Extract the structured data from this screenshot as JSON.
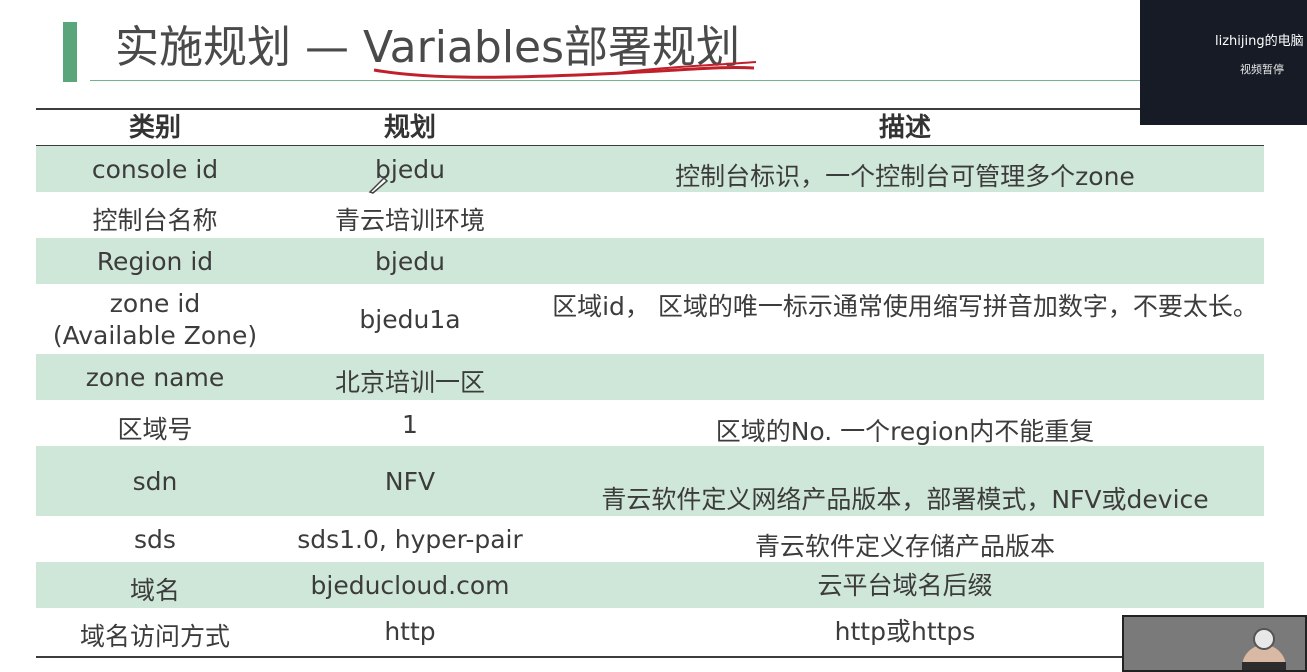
{
  "slide": {
    "title": "实施规划 — Variables部署规划",
    "table": {
      "headers": [
        "类别",
        "规划",
        "描述"
      ],
      "rows": [
        {
          "category": "console id",
          "plan": "bjedu",
          "desc": "控制台标识，一个控制台可管理多个zone",
          "shaded": true
        },
        {
          "category": "控制台名称",
          "plan": "青云培训环境",
          "desc": "",
          "shaded": false
        },
        {
          "category": "Region id",
          "plan": "bjedu",
          "desc": "",
          "shaded": true
        },
        {
          "category": "zone id\n(Available Zone)",
          "plan": "bjedu1a",
          "desc": "区域id， 区域的唯一标示通常使用缩写拼音加数字，不要太长。",
          "shaded": false
        },
        {
          "category": "zone name",
          "plan": "北京培训一区",
          "desc": "",
          "shaded": true
        },
        {
          "category": "区域号",
          "plan": "1",
          "desc": "区域的No. 一个region内不能重复",
          "shaded": false
        },
        {
          "category": "sdn",
          "plan": "NFV",
          "desc": "青云软件定义网络产品版本，部署模式，NFV或device",
          "shaded": true
        },
        {
          "category": "sds",
          "plan": "sds1.0, hyper-pair",
          "desc": "青云软件定义存储产品版本",
          "shaded": false
        },
        {
          "category": "域名",
          "plan": "bjeducloud.com",
          "desc": "云平台域名后缀",
          "shaded": true
        },
        {
          "category": "域名访问方式",
          "plan": "http",
          "desc": "http或https",
          "shaded": false
        }
      ]
    }
  },
  "video_overlay": {
    "name": "lizhijing的电脑",
    "status": "视频暂停"
  },
  "colors": {
    "accent": "#5aa57a",
    "row_shade": "#cfe7d8",
    "underline": "#c0202a"
  }
}
